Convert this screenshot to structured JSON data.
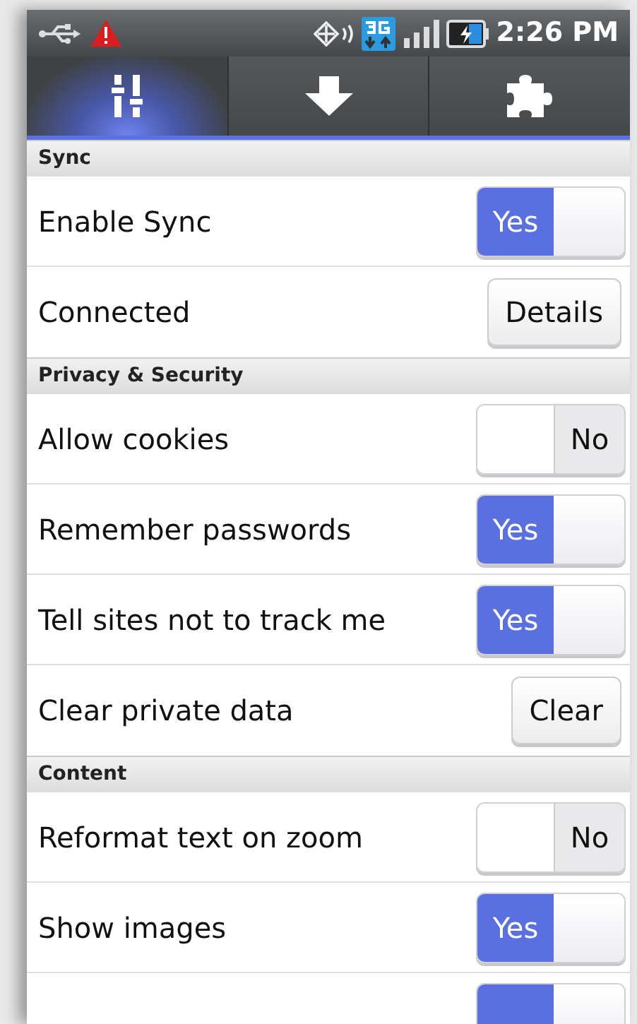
{
  "status_bar": {
    "time": "2:26 PM"
  },
  "tabs": [
    {
      "selected": true
    },
    {
      "selected": false
    },
    {
      "selected": false
    }
  ],
  "sections": [
    {
      "title": "Sync",
      "items": [
        {
          "kind": "toggle",
          "label": "Enable Sync",
          "on": true,
          "state_label": "Yes"
        },
        {
          "kind": "button",
          "label": "Connected",
          "button": "Details"
        }
      ]
    },
    {
      "title": "Privacy & Security",
      "items": [
        {
          "kind": "toggle",
          "label": "Allow cookies",
          "on": false,
          "state_label": "No"
        },
        {
          "kind": "toggle",
          "label": "Remember passwords",
          "on": true,
          "state_label": "Yes"
        },
        {
          "kind": "toggle",
          "label": "Tell sites not to track me",
          "on": true,
          "state_label": "Yes"
        },
        {
          "kind": "button",
          "label": "Clear private data",
          "button": "Clear"
        }
      ]
    },
    {
      "title": "Content",
      "items": [
        {
          "kind": "toggle",
          "label": "Reformat text on zoom",
          "on": false,
          "state_label": "No"
        },
        {
          "kind": "toggle",
          "label": "Show images",
          "on": true,
          "state_label": "Yes"
        },
        {
          "kind": "toggle",
          "on": true
        }
      ]
    }
  ]
}
